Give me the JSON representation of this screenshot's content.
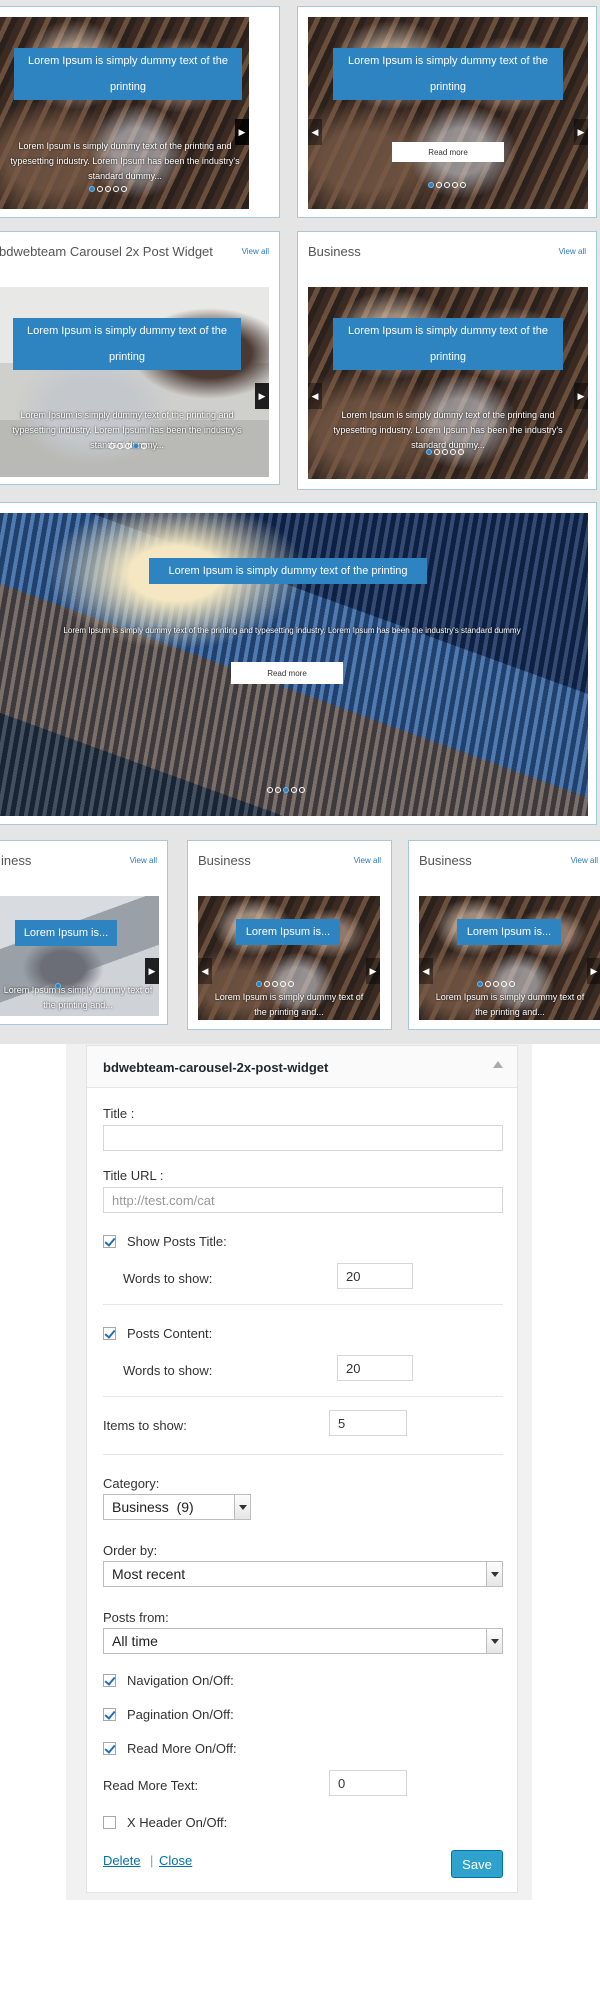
{
  "showcase": {
    "caption_long": "Lorem Ipsum is simply dummy text of the printing",
    "caption_short": "Lorem Ipsum is...",
    "excerpt_long": "Lorem Ipsum is simply dummy text of the printing and typesetting industry. Lorem Ipsum has been the industry's standard dummy...",
    "excerpt_hero": "Lorem Ipsum is simply dummy text of the printing and typesetting industry. Lorem Ipsum has been the industry's standard dummy",
    "excerpt_short": "Lorem Ipsum is simply dummy text of the printing and...",
    "read_more": "Read more",
    "view_all": "View all",
    "card_titles": {
      "carousel": "bdwebteam Carousel 2x Post Widget",
      "business": "Business",
      "business_cut": "iness"
    }
  },
  "widget": {
    "header_title": "bdwebteam-carousel-2x-post-widget",
    "title_label": "Title :",
    "title_value": "",
    "title_url_label": "Title URL :",
    "title_url_placeholder": "http://test.com/cat",
    "show_posts_title": {
      "label": "Show Posts Title:",
      "checked": true
    },
    "posts_title_words": {
      "label": "Words to show:",
      "value": "20"
    },
    "posts_content": {
      "label": "Posts Content:",
      "checked": true
    },
    "posts_content_words": {
      "label": "Words to show:",
      "value": "20"
    },
    "items_to_show": {
      "label": "Items to show:",
      "value": "5"
    },
    "category": {
      "label": "Category:",
      "selected": "Business  (9)"
    },
    "order_by": {
      "label": "Order by:",
      "selected": "Most recent"
    },
    "posts_from": {
      "label": "Posts from:",
      "selected": "All time"
    },
    "navigation": {
      "label": "Navigation On/Off:",
      "checked": true
    },
    "pagination": {
      "label": "Pagination On/Off:",
      "checked": true
    },
    "read_more_toggle": {
      "label": "Read More On/Off:",
      "checked": true
    },
    "read_more_text": {
      "label": "Read More Text:",
      "value": "0"
    },
    "x_header": {
      "label": "X Header On/Off:",
      "checked": false
    },
    "delete_link": "Delete",
    "separator": "|",
    "close_link": "Close",
    "save_button": "Save"
  }
}
